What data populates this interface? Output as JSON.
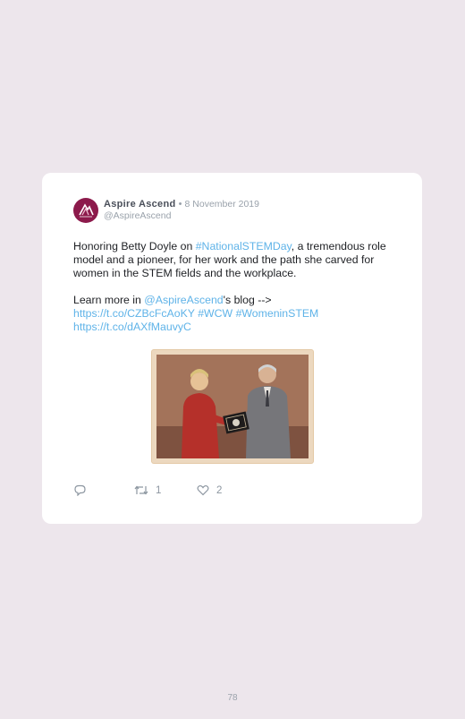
{
  "tweet": {
    "author_name": "Aspire Ascend",
    "separator": "•",
    "date": "8 November 2019",
    "handle": "@AspireAscend",
    "text_1a": "Honoring Betty Doyle on ",
    "hashtag_1": "#NationalSTEMDay",
    "text_1b": ", a tremendous role model and a pioneer, for her work and the path she carved for women in the STEM fields and the workplace.",
    "text_2a": "Learn more in ",
    "mention_1": "@AspireAscend",
    "text_2b": "'s blog -->",
    "url_1": "https://t.co/CZBcFcAoKY",
    "hashtag_2": "#WCW",
    "hashtag_3": "#WomeninSTEM",
    "url_2": "https://t.co/dAXfMauvyC",
    "retweet_count": "1",
    "like_count": "2"
  },
  "icons": {
    "reply": "reply-icon",
    "retweet": "retweet-icon",
    "like": "heart-icon",
    "avatar": "aspire-ascend-logo"
  },
  "colors": {
    "background": "#ede6ec",
    "card": "#ffffff",
    "link": "#5fb3e8",
    "avatar": "#8c1a4b"
  },
  "page_number": "78"
}
